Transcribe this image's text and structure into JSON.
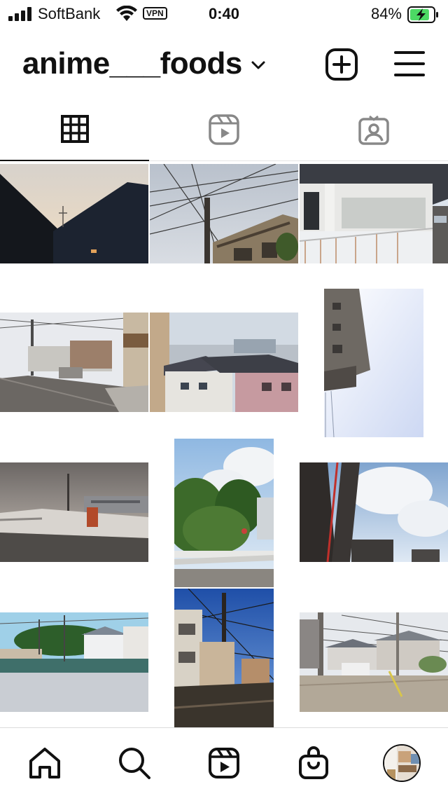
{
  "status_bar": {
    "carrier": "SoftBank",
    "vpn": "VPN",
    "time": "0:40",
    "battery_percent": "84%",
    "battery_level": 0.84,
    "battery_color": "#4cd964",
    "icons": [
      "signal-icon",
      "wifi-icon",
      "battery-charging-icon"
    ]
  },
  "header": {
    "username": "anime___foods",
    "icons": [
      "chevron-down-icon",
      "new-post-icon",
      "menu-icon"
    ]
  },
  "tabs": [
    {
      "name": "grid",
      "icon": "grid-icon",
      "active": true
    },
    {
      "name": "reels",
      "icon": "reels-icon",
      "active": false
    },
    {
      "name": "tagged",
      "icon": "tagged-icon",
      "active": false
    }
  ],
  "posts": [
    {
      "row": 1,
      "column": 1,
      "subject": "rooftop silhouette at dusk",
      "colors": [
        "#e9dccb",
        "#1c1f24"
      ]
    },
    {
      "row": 1,
      "column": 2,
      "subject": "power lines and utility pole",
      "colors": [
        "#c9cfd8",
        "#3a352f"
      ]
    },
    {
      "row": 1,
      "column": 3,
      "subject": "white building balcony",
      "colors": [
        "#dfe6ee",
        "#8b6b4a"
      ]
    },
    {
      "row": 2,
      "column": 1,
      "subject": "residential street",
      "colors": [
        "#e3e5e9",
        "#6b655f"
      ]
    },
    {
      "row": 2,
      "column": 2,
      "subject": "rooftops of houses",
      "colors": [
        "#cdd6e0",
        "#b88a8e"
      ]
    },
    {
      "row": 2,
      "column": 3,
      "subject": "tall building from below",
      "colors": [
        "#e7ecf8",
        "#5b5651"
      ]
    },
    {
      "row": 3,
      "column": 1,
      "subject": "rooftop parking at dusk",
      "colors": [
        "#b9b3ad",
        "#5e5a55"
      ]
    },
    {
      "row": 3,
      "column": 2,
      "subject": "trees and guardrail",
      "colors": [
        "#cfe0f0",
        "#3f6a2c"
      ]
    },
    {
      "row": 3,
      "column": 3,
      "subject": "concrete pillars and clouds",
      "colors": [
        "#cfe0f2",
        "#2f2b29"
      ]
    },
    {
      "row": 4,
      "column": 1,
      "subject": "empty lot with houses",
      "colors": [
        "#9fd0e8",
        "#c9cdd3"
      ]
    },
    {
      "row": 4,
      "column": 2,
      "subject": "street at sunset with wires",
      "colors": [
        "#2f5fb8",
        "#3a342c"
      ]
    },
    {
      "row": 4,
      "column": 3,
      "subject": "parking lot and houses",
      "colors": [
        "#e6e9ed",
        "#9a8f80"
      ]
    }
  ],
  "bottom_nav": [
    {
      "name": "home",
      "icon": "home-icon"
    },
    {
      "name": "search",
      "icon": "search-icon"
    },
    {
      "name": "reels",
      "icon": "reels-icon"
    },
    {
      "name": "shop",
      "icon": "shopping-bag-icon"
    },
    {
      "name": "profile",
      "icon": "avatar"
    }
  ]
}
